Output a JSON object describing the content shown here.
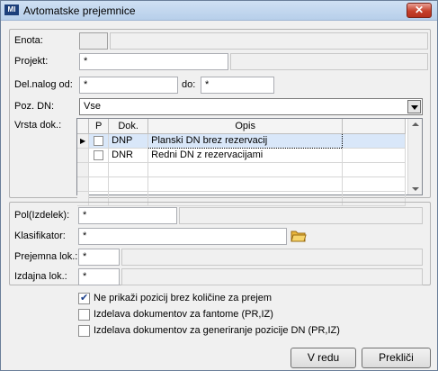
{
  "window": {
    "title": "Avtomatske prejemnice",
    "app_icon": "MI",
    "close_icon": "x-icon"
  },
  "form": {
    "enota_label": "Enota:",
    "enota_value": "",
    "projekt_label": "Projekt:",
    "projekt_value": "*",
    "del_nalog_od_label": "Del.nalog od:",
    "del_nalog_od_value": "*",
    "do_label": "do:",
    "do_value": "*",
    "poz_dn_label": "Poz. DN:",
    "poz_dn_value": "Vse",
    "vrsta_dok_label": "Vrsta dok.:"
  },
  "grid": {
    "columns": [
      "P",
      "Dok.",
      "Opis"
    ],
    "rows": [
      {
        "checked": false,
        "dok": "DNP",
        "opis": "Planski DN brez rezervacij"
      },
      {
        "checked": false,
        "dok": "DNR",
        "opis": "Redni DN z rezervacijami"
      }
    ]
  },
  "filters": {
    "pol_label": "Pol(Izdelek):",
    "pol_value": "*",
    "klasifikator_label": "Klasifikator:",
    "klasifikator_value": "*",
    "prejemna_lok_label": "Prejemna lok.:",
    "prejemna_lok_value": "*",
    "izdajna_lok_label": "Izdajna lok.:",
    "izdajna_lok_value": "*"
  },
  "options": [
    {
      "label": "Ne prikaži pozicij brez količine za prejem",
      "checked": true
    },
    {
      "label": "Izdelava dokumentov za fantome (PR,IZ)",
      "checked": false
    },
    {
      "label": "Izdelava dokumentov za generiranje pozicije DN (PR,IZ)",
      "checked": false
    }
  ],
  "buttons": {
    "ok": "V redu",
    "cancel": "Prekliči"
  }
}
